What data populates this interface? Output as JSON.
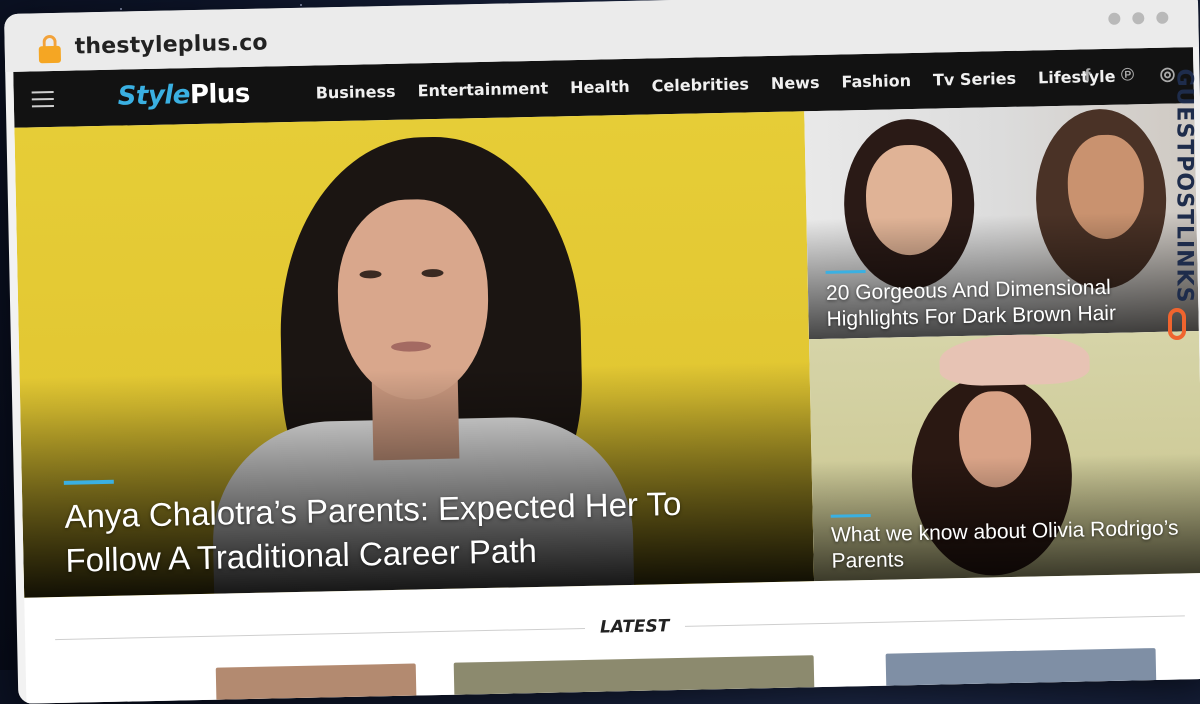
{
  "browser": {
    "url": "thestyleplus.co"
  },
  "site": {
    "logo_part1": "Style",
    "logo_part2": "Plus",
    "menu": [
      "Business",
      "Entertainment",
      "Health",
      "Celebrities",
      "News",
      "Fashion",
      "Tv Series",
      "Lifestyle"
    ],
    "social": [
      {
        "icon": "facebook-icon",
        "glyph": "f"
      },
      {
        "icon": "pinterest-icon",
        "glyph": "℗"
      },
      {
        "icon": "instagram-icon",
        "glyph": "◎"
      }
    ]
  },
  "hero": {
    "title": "Anya Chalotra’s Parents: Expected Her To Follow A Traditional Career Path"
  },
  "side_articles": [
    {
      "title": "20 Gorgeous And Dimensional Highlights For Dark Brown Hair"
    },
    {
      "title": "What we know about Olivia Rodrigo’s Parents"
    }
  ],
  "latest": {
    "label": "LATEST"
  },
  "watermark": {
    "text": "GUESTPOSTLINKS"
  },
  "colors": {
    "accent": "#3ab0e2",
    "nav_bg": "#121212",
    "hero_bg": "#e2c732"
  }
}
